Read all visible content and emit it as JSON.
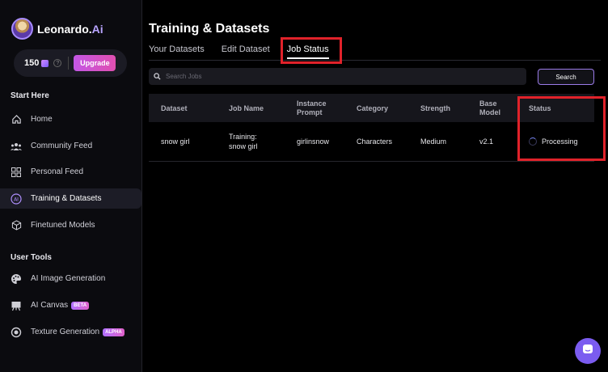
{
  "brand": {
    "name": "Leonardo.",
    "suffix": "Ai"
  },
  "credits": {
    "count": "150",
    "upgrade_label": "Upgrade"
  },
  "sidebar": {
    "section1": "Start Here",
    "items": [
      {
        "label": "Home",
        "icon": "home-icon"
      },
      {
        "label": "Community Feed",
        "icon": "community-icon"
      },
      {
        "label": "Personal Feed",
        "icon": "grid-icon"
      },
      {
        "label": "Training & Datasets",
        "icon": "training-icon"
      },
      {
        "label": "Finetuned Models",
        "icon": "cube-icon"
      }
    ],
    "section2": "User Tools",
    "tools": [
      {
        "label": "AI Image Generation",
        "icon": "palette-icon",
        "badge": ""
      },
      {
        "label": "AI Canvas",
        "icon": "easel-icon",
        "badge": "BETA"
      },
      {
        "label": "Texture Generation",
        "icon": "texture-icon",
        "badge": "ALPHA"
      }
    ]
  },
  "main": {
    "title": "Training & Datasets",
    "tabs": [
      "Your Datasets",
      "Edit Dataset",
      "Job Status"
    ],
    "search_placeholder": "Search Jobs",
    "search_button": "Search"
  },
  "table": {
    "headers": [
      "Dataset",
      "Job Name",
      "Instance Prompt",
      "Category",
      "Strength",
      "Base Model",
      "Status"
    ],
    "rows": [
      {
        "dataset": "snow girl",
        "job_name": "Training: snow girl",
        "instance_prompt": "girlinsnow",
        "category": "Characters",
        "strength": "Medium",
        "base_model": "v2.1",
        "status": "Processing"
      }
    ]
  },
  "colors": {
    "accent": "#9b7be8",
    "highlight": "#e0222a",
    "upgrade": "#d453c8"
  }
}
